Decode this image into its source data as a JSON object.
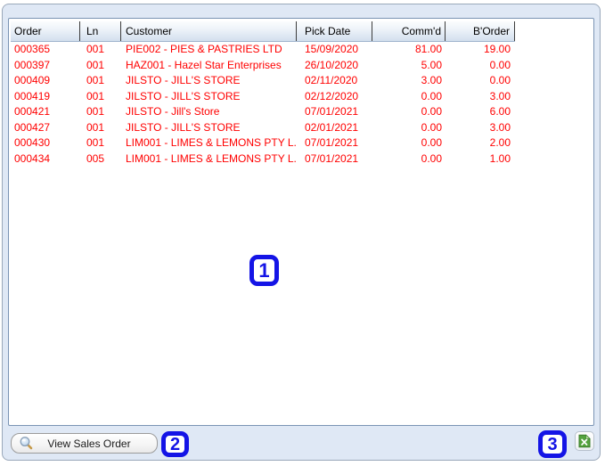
{
  "table": {
    "columns": [
      {
        "label": "Order"
      },
      {
        "label": "Ln"
      },
      {
        "label": "Customer"
      },
      {
        "label": "Pick Date"
      },
      {
        "label": "Comm'd"
      },
      {
        "label": "B'Order"
      }
    ],
    "rows": [
      {
        "order": "000365",
        "ln": "001",
        "customer": "PIE002 - PIES & PASTRIES LTD",
        "pick_date": "15/09/2020",
        "commd": "81.00",
        "border": "19.00"
      },
      {
        "order": "000397",
        "ln": "001",
        "customer": "HAZ001 - Hazel Star Enterprises",
        "pick_date": "26/10/2020",
        "commd": "5.00",
        "border": "0.00"
      },
      {
        "order": "000409",
        "ln": "001",
        "customer": "JILSTO - JILL'S STORE",
        "pick_date": "02/11/2020",
        "commd": "3.00",
        "border": "0.00"
      },
      {
        "order": "000419",
        "ln": "001",
        "customer": "JILSTO - JILL'S STORE",
        "pick_date": "02/12/2020",
        "commd": "0.00",
        "border": "3.00"
      },
      {
        "order": "000421",
        "ln": "001",
        "customer": "JILSTO - Jill's Store",
        "pick_date": "07/01/2021",
        "commd": "0.00",
        "border": "6.00"
      },
      {
        "order": "000427",
        "ln": "001",
        "customer": "JILSTO - JILL'S STORE",
        "pick_date": "02/01/2021",
        "commd": "0.00",
        "border": "3.00"
      },
      {
        "order": "000430",
        "ln": "001",
        "customer": "LIM001 - LIMES & LEMONS PTY L...",
        "pick_date": "07/01/2021",
        "commd": "0.00",
        "border": "2.00"
      },
      {
        "order": "000434",
        "ln": "005",
        "customer": "LIM001 - LIMES & LEMONS PTY L...",
        "pick_date": "07/01/2021",
        "commd": "0.00",
        "border": "1.00"
      }
    ]
  },
  "toolbar": {
    "view_sales_order_label": "View Sales Order",
    "magnifier_icon": "magnifier-icon",
    "excel_icon": "excel-export-icon"
  },
  "callouts": {
    "one": "1",
    "two": "2",
    "three": "3"
  },
  "colors": {
    "row_text_red": "#ff0000",
    "callout_blue": "#1414e6",
    "window_background": "#dfe8f5",
    "panel_border": "#7a94b4",
    "excel_green": "#54a33e"
  }
}
